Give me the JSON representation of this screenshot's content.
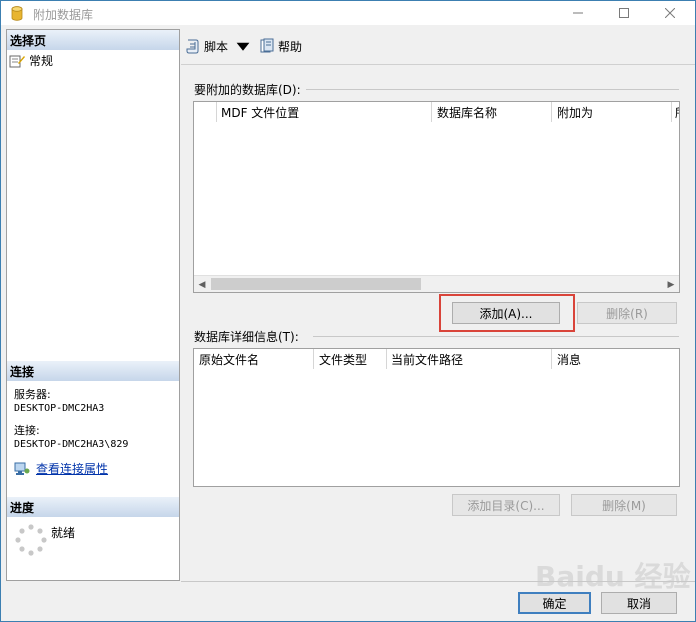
{
  "window": {
    "title": "附加数据库"
  },
  "left": {
    "select_page_header": "选择页",
    "pages": [
      {
        "label": "常规"
      }
    ],
    "connection_header": "连接",
    "server_label": "服务器:",
    "server_value": "DESKTOP-DMC2HA3",
    "connection_label": "连接:",
    "connection_value": "DESKTOP-DMC2HA3\\829",
    "view_props_link": "查看连接属性",
    "progress_header": "进度",
    "progress_status": "就绪"
  },
  "toolbar": {
    "script_label": "脚本",
    "help_label": "帮助"
  },
  "attach": {
    "label": "要附加的数据库(D):",
    "columns": [
      "MDF 文件位置",
      "数据库名称",
      "附加为",
      "所"
    ],
    "add_button": "添加(A)...",
    "remove_button": "删除(R)"
  },
  "details": {
    "label": "数据库详细信息(T):",
    "columns": [
      "原始文件名",
      "文件类型",
      "当前文件路径",
      "消息"
    ],
    "add_catalog_button": "添加目录(C)...",
    "remove_button": "删除(M)"
  },
  "footer": {
    "ok_button": "确定",
    "cancel_button": "取消"
  },
  "watermark": "Baidu 经验",
  "colors": {
    "accent": "#3c7fb1",
    "highlight": "#d9443a",
    "link": "#0033aa"
  }
}
